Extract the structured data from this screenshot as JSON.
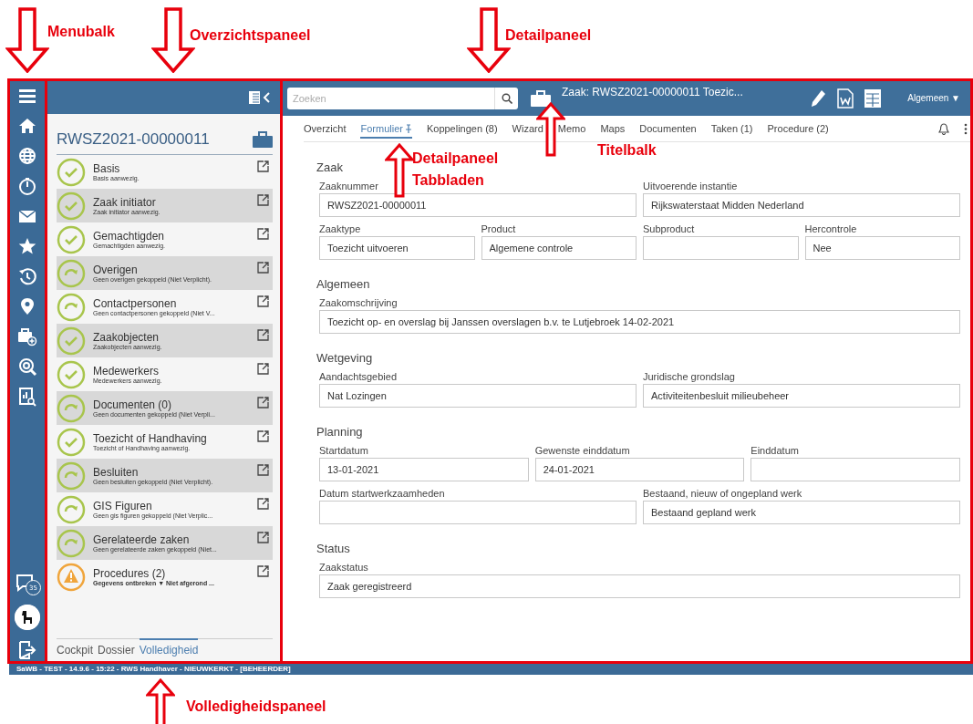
{
  "annotations": [
    {
      "kind": "down",
      "label": "Menubalk"
    },
    {
      "kind": "down",
      "label": "Overzichtspaneel"
    },
    {
      "kind": "down",
      "label": "Detailpaneel"
    },
    {
      "kind": "up",
      "label": "Detailpaneel Tabbladen"
    },
    {
      "kind": "up",
      "label": "Titelbalk"
    },
    {
      "kind": "up",
      "label": "Volledigheidspaneel"
    }
  ],
  "menubar": {
    "badge": "35"
  },
  "overview": {
    "title": "RWSZ2021-00000011",
    "items": [
      {
        "name": "Basis",
        "note": "Basis aanwezig.",
        "kind": "done"
      },
      {
        "name": "Zaak initiator",
        "note": "Zaak initiator aanwezig.",
        "kind": "done"
      },
      {
        "name": "Gemachtigden",
        "note": "Gemachtigden aanwezig.",
        "kind": "done"
      },
      {
        "name": "Overigen",
        "note": "Geen overigen gekoppeld (Niet Verplicht).",
        "kind": "skipped"
      },
      {
        "name": "Contactpersonen",
        "note": "Geen contactpersonen gekoppeld (Niet V...",
        "kind": "skipped"
      },
      {
        "name": "Zaakobjecten",
        "note": "Zaakobjecten aanwezig.",
        "kind": "done"
      },
      {
        "name": "Medewerkers",
        "note": "Medewerkers aanwezig.",
        "kind": "done"
      },
      {
        "name": "Documenten (0)",
        "note": "Geen documenten gekoppeld (Niet Verpli...",
        "kind": "skipped"
      },
      {
        "name": "Toezicht of Handhaving",
        "note": "Toezicht of Handhaving aanwezig.",
        "kind": "done"
      },
      {
        "name": "Besluiten",
        "note": "Geen besluiten gekoppeld (Niet Verplicht).",
        "kind": "skipped"
      },
      {
        "name": "GIS Figuren",
        "note": "Geen gis figuren gekoppeld (Niet Verplic...",
        "kind": "skipped"
      },
      {
        "name": "Gerelateerde zaken",
        "note": "Geen gerelateerde zaken gekoppeld (Niet...",
        "kind": "skipped"
      },
      {
        "name": "Procedures (2)",
        "note": "Gegevens ontbreken ▼ Niet afgerond ...",
        "kind": "warning"
      }
    ],
    "tabs": [
      {
        "label": "Cockpit",
        "selected": false
      },
      {
        "label": "Dossier",
        "selected": false
      },
      {
        "label": "Volledigheid",
        "selected": true
      }
    ]
  },
  "detail": {
    "search": {
      "placeholder": "Zoeken"
    },
    "title": "Zaak: RWSZ2021-00000011 Toezic...",
    "menu": "Algemeen ▼",
    "tabs": [
      {
        "label": "Overzicht",
        "selected": false
      },
      {
        "label": "Formulier",
        "selected": true
      },
      {
        "label": "Koppelingen (8)",
        "selected": false
      },
      {
        "label": "Wizard",
        "selected": false
      },
      {
        "label": "Memo",
        "selected": false
      },
      {
        "label": "Maps",
        "selected": false
      },
      {
        "label": "Documenten",
        "selected": false
      },
      {
        "label": "Taken (1)",
        "selected": false
      },
      {
        "label": "Procedure (2)",
        "selected": false
      }
    ],
    "sections": [
      {
        "title": "Zaak",
        "rows": [
          {
            "fields": [
              {
                "label": "Zaaknummer",
                "value": "RWSZ2021-00000011"
              },
              {
                "label": "Uitvoerende instantie",
                "value": "Rijkswaterstaat Midden Nederland"
              }
            ]
          },
          {
            "fields": [
              {
                "label": "Zaaktype",
                "value": "Toezicht uitvoeren"
              },
              {
                "label": "Product",
                "value": "Algemene controle"
              },
              {
                "label": "Subproduct"
              },
              {
                "label": "Hercontrole",
                "value": "Nee"
              }
            ]
          }
        ]
      },
      {
        "title": "Algemeen",
        "rows": [
          {
            "fields": [
              {
                "label": "Zaakomschrijving",
                "value": "Toezicht op- en overslag bij Janssen overslagen b.v. te Lutjebroek 14-02-2021"
              }
            ]
          }
        ]
      },
      {
        "title": "Wetgeving",
        "rows": [
          {
            "fields": [
              {
                "label": "Aandachtsgebied",
                "value": "Nat Lozingen"
              },
              {
                "label": "Juridische grondslag",
                "value": "Activiteitenbesluit milieubeheer"
              }
            ]
          }
        ]
      },
      {
        "title": "Planning",
        "rows": [
          {
            "fields": [
              {
                "label": "Startdatum",
                "value": "13-01-2021"
              },
              {
                "label": "Gewenste einddatum",
                "value": "24-01-2021"
              },
              {
                "label": "Einddatum"
              }
            ]
          },
          {
            "fields": [
              {
                "label": "Datum startwerkzaamheden"
              },
              {
                "label": "Bestaand, nieuw of ongepland werk",
                "value": "Bestaand gepland werk"
              }
            ]
          }
        ]
      },
      {
        "title": "Status",
        "rows": [
          {
            "fields": [
              {
                "label": "Zaakstatus",
                "value": "Zaak geregistreerd"
              }
            ]
          }
        ]
      }
    ]
  },
  "status_bar": "SaWB - TEST - 14.9.6 - 15:22 - RWS Handhaver - NIEUWKERKT - [BEHEERDER]"
}
